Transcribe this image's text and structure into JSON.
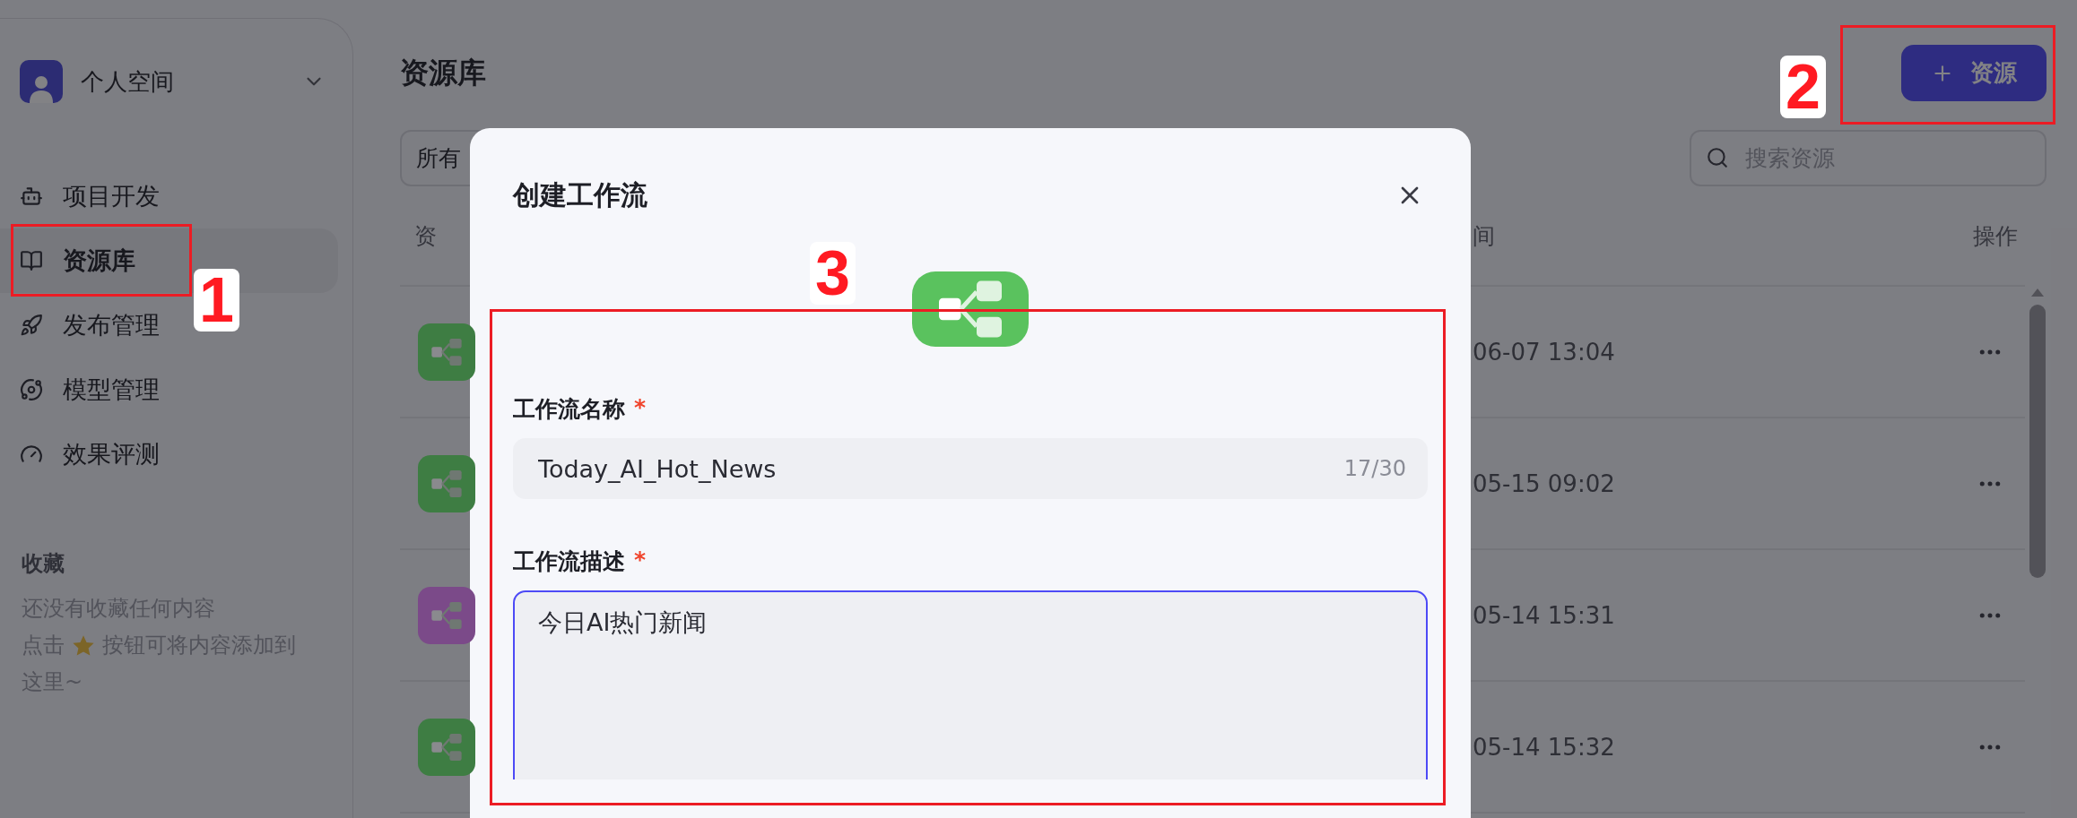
{
  "sidebar": {
    "workspace": "个人空间",
    "nav": [
      {
        "label": "项目开发",
        "selected": false
      },
      {
        "label": "资源库",
        "selected": true
      },
      {
        "label": "发布管理",
        "selected": false
      },
      {
        "label": "模型管理",
        "selected": false
      },
      {
        "label": "效果评测",
        "selected": false
      }
    ],
    "favorites": {
      "title": "收藏",
      "empty_text": "还没有收藏任何内容",
      "hint_before": "点击",
      "hint_after": "按钮可将内容添加到",
      "hint_end": "这里~"
    }
  },
  "main": {
    "title": "资源库",
    "add_button": "资源",
    "filter": "所有",
    "search": {
      "placeholder": "搜索资源"
    },
    "table": {
      "columns": [
        "资",
        "间",
        "操作"
      ],
      "rows": [
        {
          "color": "#3e7d43",
          "time": "06-07 13:04"
        },
        {
          "color": "#3e7d43",
          "time": "05-15 09:02"
        },
        {
          "color": "#7b4a89",
          "time": "05-14 15:31"
        },
        {
          "color": "#3e7d43",
          "time": "05-14 15:32"
        }
      ]
    }
  },
  "modal": {
    "title": "创建工作流",
    "fields": [
      {
        "kind": "input",
        "label": "工作流名称",
        "mark": "*",
        "value": "Today_AI_Hot_News",
        "counter": "17/30",
        "focused": false
      },
      {
        "kind": "textarea",
        "label": "工作流描述",
        "mark": "*",
        "value": "今日AI热门新闻",
        "focused": true
      }
    ]
  },
  "annotations": [
    {
      "label": "1"
    },
    {
      "label": "2"
    },
    {
      "label": "3"
    }
  ]
}
